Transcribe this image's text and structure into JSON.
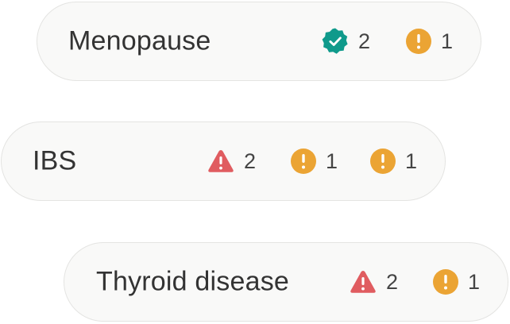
{
  "conditions": [
    {
      "label": "Menopause",
      "badges": [
        {
          "icon": "verified-check-icon",
          "count": "2",
          "color": "#0f9a8b"
        },
        {
          "icon": "info-exclamation-icon",
          "count": "1",
          "color": "#eba434"
        }
      ]
    },
    {
      "label": "IBS",
      "badges": [
        {
          "icon": "warning-triangle-icon",
          "count": "2",
          "color": "#e05c60"
        },
        {
          "icon": "info-exclamation-icon",
          "count": "1",
          "color": "#eba434"
        },
        {
          "icon": "info-exclamation-icon",
          "count": "1",
          "color": "#eba434"
        }
      ]
    },
    {
      "label": "Thyroid disease",
      "badges": [
        {
          "icon": "warning-triangle-icon",
          "count": "2",
          "color": "#e05c60"
        },
        {
          "icon": "info-exclamation-icon",
          "count": "1",
          "color": "#eba434"
        }
      ]
    }
  ]
}
